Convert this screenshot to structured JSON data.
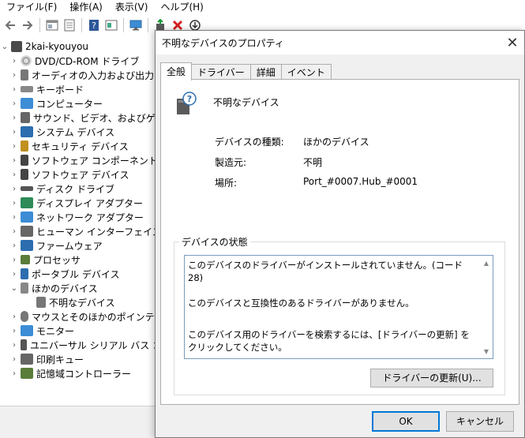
{
  "menubar": {
    "items": [
      "ファイル(F)",
      "操作(A)",
      "表示(V)",
      "ヘルプ(H)"
    ]
  },
  "toolbar": {
    "icons": [
      "back-arrow-icon",
      "forward-arrow-icon",
      "properties-icon",
      "list-icon",
      "help-icon",
      "view-icon",
      "monitor-icon",
      "update-driver-icon",
      "uninstall-icon",
      "scan-icon"
    ]
  },
  "tree": {
    "root": "2kai-kyouyou",
    "items": [
      "DVD/CD-ROM ドライブ",
      "オーディオの入力および出力",
      "キーボード",
      "コンピューター",
      "サウンド、ビデオ、およびゲーム コントローラー",
      "システム デバイス",
      "セキュリティ デバイス",
      "ソフトウェア コンポーネント",
      "ソフトウェア デバイス",
      "ディスク ドライブ",
      "ディスプレイ アダプター",
      "ネットワーク アダプター",
      "ヒューマン インターフェイス デバイス",
      "ファームウェア",
      "プロセッサ",
      "ポータブル デバイス",
      "ほかのデバイス",
      "不明なデバイス",
      "マウスとそのほかのポインティング デバイス",
      "モニター",
      "ユニバーサル シリアル バス コントローラー",
      "印刷キュー",
      "記憶域コントローラー"
    ]
  },
  "dialog": {
    "title": "不明なデバイスのプロパティ",
    "close": "✕",
    "tabs": [
      "全般",
      "ドライバー",
      "詳細",
      "イベント"
    ],
    "device_name": "不明なデバイス",
    "properties": {
      "type_label": "デバイスの種類:",
      "type_value": "ほかのデバイス",
      "mfr_label": "製造元:",
      "mfr_value": "不明",
      "loc_label": "場所:",
      "loc_value": "Port_#0007.Hub_#0001"
    },
    "status_group_title": "デバイスの状態",
    "status_lines": [
      "このデバイスのドライバーがインストールされていません。(コード 28)",
      "このデバイスと互換性のあるドライバーがありません。",
      "このデバイス用のドライバーを検索するには、[ドライバーの更新] をクリックしてください。"
    ],
    "update_button": "ドライバーの更新(U)...",
    "ok_button": "OK",
    "cancel_button": "キャンセル"
  }
}
